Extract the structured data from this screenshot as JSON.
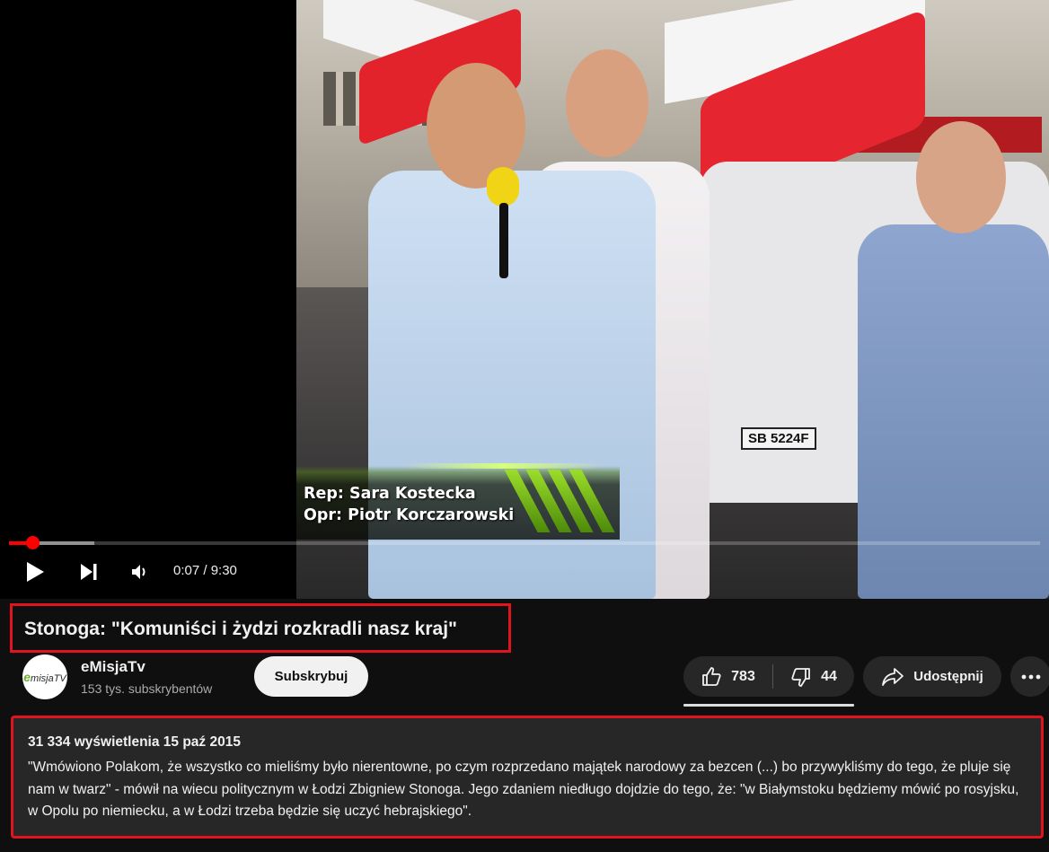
{
  "player": {
    "overlay_line1": "Rep: Sara Kostecka",
    "overlay_line2": "Opr: Piotr Korczarowski",
    "plate": "SB 5224F",
    "current_time": "0:07",
    "duration": "9:30",
    "time_display": "0:07 / 9:30",
    "progress_played_fraction": 0.023,
    "progress_loaded_fraction": 0.083,
    "icons": [
      "play-icon",
      "next-icon",
      "volume-icon"
    ]
  },
  "video": {
    "title": "Stonoga: \"Komuniści i żydzi rozkradli nasz kraj\""
  },
  "channel": {
    "name": "eMisjaTv",
    "subscribers": "153 tys. subskrybentów",
    "avatar_text": "misjaTV",
    "avatar_letter": "e",
    "subscribe_label": "Subskrybuj"
  },
  "actions": {
    "likes": "783",
    "dislikes": "44",
    "share_label": "Udostępnij"
  },
  "description": {
    "meta": "31 334 wyświetlenia  15 paź 2015",
    "text": "\"Wmówiono Polakom, że wszystko co mieliśmy było nierentowne, po czym rozprzedano majątek narodowy za bezcen (...) bo przywykliśmy do tego, że pluje się nam w twarz\" - mówił na wiecu politycznym w Łodzi Zbigniew Stonoga. Jego zdaniem niedługo dojdzie do tego, że: \"w Białymstoku będziemy mówić po rosyjsku, w Opolu po niemiecku, a w Łodzi trzeba będzie się uczyć hebrajskiego\"."
  },
  "colors": {
    "accent": "#ff0000",
    "highlight_border": "#e0141f",
    "background": "#0f0f0f",
    "pill": "#272727"
  }
}
